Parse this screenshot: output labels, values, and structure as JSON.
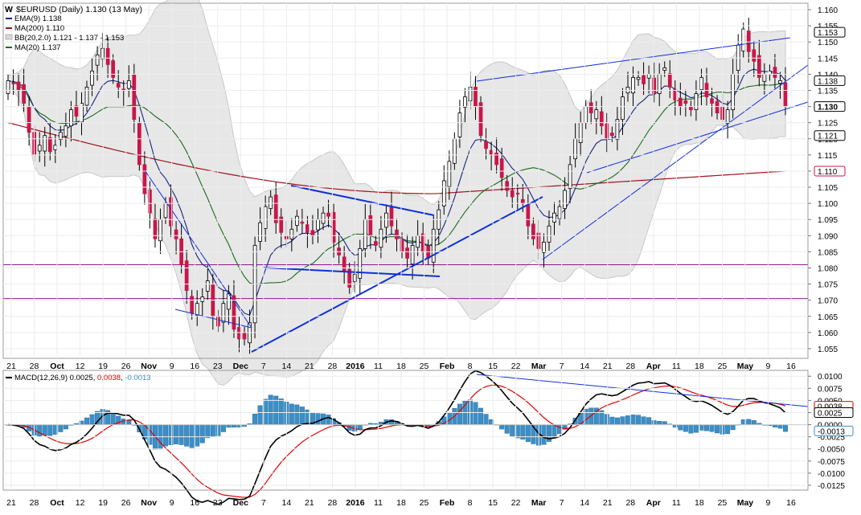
{
  "header": {
    "symbol_title": "$EURUSD (Daily) 1.130 (13 May)",
    "legend": [
      {
        "label": "EMA(9) 1.138",
        "color": "#1a237e",
        "swatch": "line"
      },
      {
        "label": "MA(200) 1.110",
        "color": "#a0101c",
        "swatch": "line"
      },
      {
        "label": "BB(20,2.0) 1.121 - 1.137 - 1.153",
        "color": "#b5b5b5",
        "swatch": "box"
      },
      {
        "label": "MA(20) 1.137",
        "color": "#1b6b1b",
        "swatch": "line"
      }
    ],
    "macd_title_prefix": "MACD(12,26,9) 0.0025, ",
    "macd_signal_value": "0.0038",
    "macd_title_sep": ", ",
    "macd_hist_value": "-0.0013"
  },
  "colors": {
    "up_candle": "#ffffff",
    "down_candle": "#c8174a",
    "ema": "#1a237e",
    "ma200": "#a0101c",
    "ma20": "#1b6b1b",
    "bb_fill": "#e3e3e3",
    "trendline": "#1030d8",
    "hline": "#8b1a8b",
    "macd_line": "#000000",
    "signal_line": "#e00000",
    "histogram": "#3a8fc8"
  },
  "chart_data": {
    "type": "candlestick",
    "price_axis": {
      "ticks": [
        "1.160",
        "1.155",
        "1.150",
        "1.145",
        "1.140",
        "1.135",
        "1.130",
        "1.125",
        "1.120",
        "1.115",
        "1.110",
        "1.105",
        "1.100",
        "1.095",
        "1.090",
        "1.085",
        "1.080",
        "1.075",
        "1.070",
        "1.065",
        "1.060",
        "1.055"
      ],
      "range": [
        1.052,
        1.162
      ]
    },
    "price_labels": [
      {
        "label": "1.153",
        "style": "outline"
      },
      {
        "label": "1.138",
        "style": "outline"
      },
      {
        "label": "1.130",
        "style": "bold"
      },
      {
        "label": "1.121",
        "style": "outline"
      },
      {
        "label": "1.110",
        "style": "red"
      }
    ],
    "x_axis_labels": [
      "21",
      "28",
      "Oct",
      "12",
      "19",
      "26",
      "Nov",
      "9",
      "16",
      "23",
      "Dec",
      "7",
      "14",
      "21",
      "28",
      "2016",
      "11",
      "18",
      "25",
      "Feb",
      "8",
      "15",
      "22",
      "Mar",
      "7",
      "14",
      "21",
      "28",
      "Apr",
      "11",
      "18",
      "25",
      "May",
      "9",
      "16"
    ],
    "macd_axis": {
      "ticks": [
        "0.0100",
        "0.0075",
        "0.0050",
        "0.0025",
        "0.0000",
        "-0.0025",
        "-0.0050",
        "-0.0075",
        "-0.0100",
        "-0.0125"
      ],
      "range": [
        -0.0135,
        0.0112
      ]
    },
    "macd_labels": [
      "0.0038",
      "0.0025",
      "-0.0013"
    ],
    "series": [
      {
        "name": "EMA(9)",
        "last": 1.138
      },
      {
        "name": "MA(200)",
        "last": 1.11
      },
      {
        "name": "MA(20)",
        "last": 1.137
      },
      {
        "name": "BB upper",
        "last": 1.153
      },
      {
        "name": "BB lower",
        "last": 1.121
      }
    ],
    "horizontal_lines": [
      1.081,
      1.0705
    ],
    "close_path": [
      1.138,
      1.137,
      1.135,
      1.131,
      1.122,
      1.115,
      1.118,
      1.121,
      1.116,
      1.118,
      1.122,
      1.124,
      1.129,
      1.127,
      1.131,
      1.136,
      1.141,
      1.146,
      1.148,
      1.143,
      1.139,
      1.136,
      1.135,
      1.138,
      1.126,
      1.112,
      1.103,
      1.097,
      1.089,
      1.095,
      1.1,
      1.093,
      1.089,
      1.081,
      1.073,
      1.066,
      1.069,
      1.071,
      1.076,
      1.065,
      1.062,
      1.069,
      1.072,
      1.061,
      1.058,
      1.058,
      1.063,
      1.087,
      1.094,
      1.099,
      1.102,
      1.094,
      1.091,
      1.089,
      1.092,
      1.096,
      1.094,
      1.091,
      1.09,
      1.095,
      1.097,
      1.096,
      1.088,
      1.084,
      1.079,
      1.074,
      1.078,
      1.086,
      1.095,
      1.09,
      1.087,
      1.092,
      1.097,
      1.093,
      1.089,
      1.085,
      1.083,
      1.087,
      1.09,
      1.085,
      1.083,
      1.092,
      1.098,
      1.107,
      1.113,
      1.12,
      1.128,
      1.133,
      1.136,
      1.13,
      1.121,
      1.117,
      1.115,
      1.112,
      1.108,
      1.104,
      1.102,
      1.103,
      1.1,
      1.093,
      1.089,
      1.086,
      1.088,
      1.093,
      1.097,
      1.099,
      1.104,
      1.112,
      1.12,
      1.125,
      1.13,
      1.128,
      1.129,
      1.124,
      1.12,
      1.121,
      1.126,
      1.133,
      1.136,
      1.139,
      1.139,
      1.137,
      1.14,
      1.134,
      1.14,
      1.142,
      1.136,
      1.132,
      1.13,
      1.131,
      1.129,
      1.134,
      1.139,
      1.133,
      1.131,
      1.128,
      1.126,
      1.129,
      1.14,
      1.149,
      1.154,
      1.147,
      1.144,
      1.139,
      1.14,
      1.141,
      1.139,
      1.138,
      1.13
    ],
    "trendlines_note": "blue trendlines, wedges and triangles as drawn"
  }
}
